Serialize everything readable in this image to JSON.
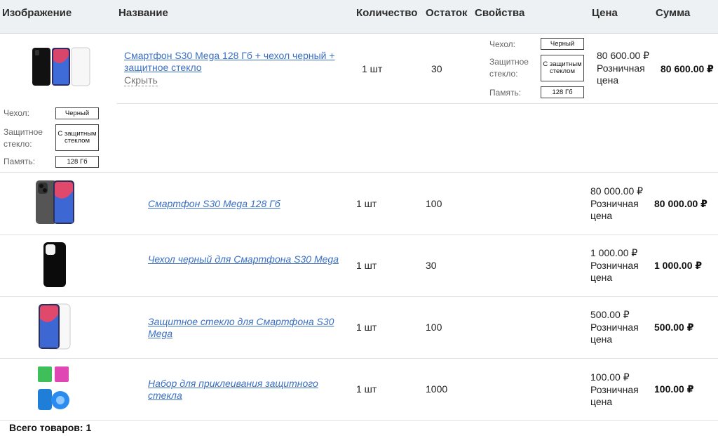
{
  "header": {
    "image": "Изображение",
    "name": "Название",
    "qty": "Количество",
    "stock": "Остаток",
    "props": "Свойства",
    "price": "Цена",
    "sum": "Сумма"
  },
  "main_item": {
    "name": "Смартфон S30 Mega 128 Гб + чехол черный + защитное стекло",
    "hide_label": "Скрыть",
    "qty": "1 шт",
    "stock": "30",
    "price": "80 600.00 ₽",
    "price_type": "Розничная цена",
    "sum": "80 600.00 ₽",
    "props": [
      {
        "label": "Чехол:",
        "value": "Черный"
      },
      {
        "label": "Защитное стекло:",
        "value": "С защитным стеклом"
      },
      {
        "label": "Память:",
        "value": "128 Гб"
      }
    ]
  },
  "sub_items": [
    {
      "name": "Смартфон S30 Mega 128 Гб",
      "qty": "1 шт",
      "stock": "100",
      "price": "80 000.00 ₽",
      "price_type": "Розничная цена",
      "sum": "80 000.00 ₽",
      "icon": "phone-gray"
    },
    {
      "name": "Чехол черный для Смартфона S30 Mega",
      "qty": "1 шт",
      "stock": "30",
      "price": "1 000.00 ₽",
      "price_type": "Розничная цена",
      "sum": "1 000.00 ₽",
      "icon": "case-black"
    },
    {
      "name": "Защитное стекло для Смартфона S30 Mega",
      "qty": "1 шт",
      "stock": "100",
      "price": "500.00 ₽",
      "price_type": "Розничная цена",
      "sum": "500.00 ₽",
      "icon": "screen-glass"
    },
    {
      "name": "Набор для приклеивания защитного стекла",
      "qty": "1 шт",
      "stock": "1000",
      "price": "100.00 ₽",
      "price_type": "Розничная цена",
      "sum": "100.00 ₽",
      "icon": "sticker-kit"
    }
  ],
  "footer": {
    "total_label": "Всего товаров: 1"
  },
  "colors": {
    "link": "#3a6fc4",
    "header_bg": "#edf1f4"
  }
}
